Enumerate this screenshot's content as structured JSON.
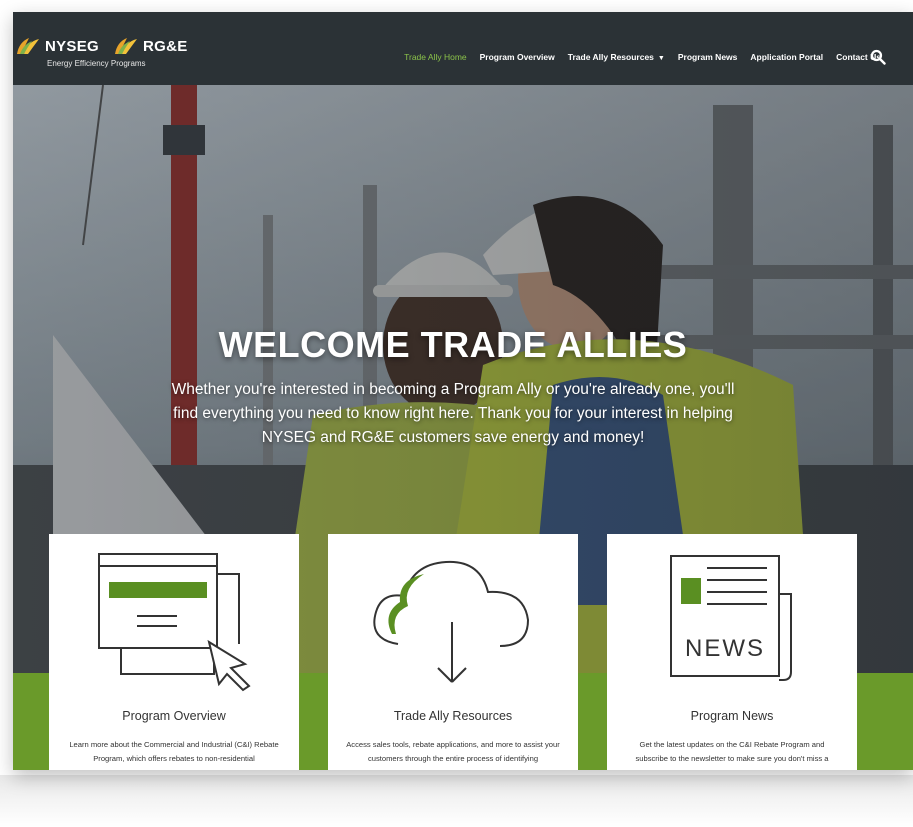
{
  "brand": {
    "name1": "NYSEG",
    "name2": "RG&E",
    "tagline": "Energy Efficiency Programs"
  },
  "nav": {
    "items": [
      {
        "label": "Trade Ally Home",
        "active": true
      },
      {
        "label": "Program Overview"
      },
      {
        "label": "Trade Ally Resources",
        "dropdown": true
      },
      {
        "label": "Program News"
      },
      {
        "label": "Application Portal"
      },
      {
        "label": "Contact Us"
      }
    ],
    "search_icon": "search-icon"
  },
  "hero": {
    "title": "WELCOME TRADE  ALLIES",
    "text": "Whether you're interested in becoming a Program Ally or you're already one, you'll find everything you need to know right here. Thank you for your interest in helping NYSEG and RG&E customers save energy and money!"
  },
  "cards": [
    {
      "title": "Program Overview",
      "icon": "browser-window-cursor-icon",
      "desc": "Learn more about the Commercial and Industrial (C&I) Rebate Program, which offers rebates to non-residential"
    },
    {
      "title": "Trade Ally Resources",
      "icon": "cloud-download-icon",
      "desc": "Access sales tools, rebate applications, and more to assist your customers through the entire process of identifying"
    },
    {
      "title": "Program News",
      "icon": "newspaper-icon",
      "icon_text": "NEWS",
      "desc": "Get the latest updates on the C&I Rebate Program and subscribe to the newsletter to make sure you don't miss a"
    }
  ],
  "colors": {
    "nav_bg": "#2b3236",
    "accent_green": "#6a9a2a",
    "active_link": "#8bc34a"
  }
}
